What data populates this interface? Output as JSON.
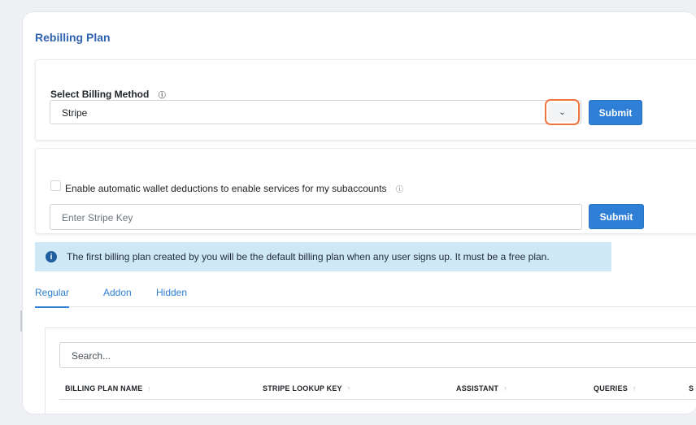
{
  "title": "Rebilling Plan",
  "billing_method": {
    "label": "Select Billing Method",
    "selected": "Stripe",
    "submit_label": "Submit"
  },
  "wallet": {
    "checkbox_label": "Enable automatic wallet deductions to enable services for my subaccounts",
    "checked": false,
    "stripe_key_placeholder": "Enter Stripe Key",
    "submit_label": "Submit"
  },
  "alert": {
    "text": "The first billing plan created by you will be the default billing plan when any user signs up. It must be a free plan."
  },
  "tabs": [
    {
      "label": "Regular",
      "active": true
    },
    {
      "label": "Addon",
      "active": false
    },
    {
      "label": "Hidden",
      "active": false
    }
  ],
  "table": {
    "search_placeholder": "Search...",
    "columns": [
      "BILLING PLAN NAME",
      "STRIPE LOOKUP KEY",
      "ASSISTANT",
      "QUERIES",
      "S"
    ]
  },
  "colors": {
    "accent": "#2f7fd6",
    "title": "#2f63b0",
    "highlight": "#f0743e",
    "alert_bg": "#cfe8f6"
  },
  "icons": {
    "info": "info-icon",
    "chevron": "chevron-down-icon",
    "alert": "info-circle-icon",
    "sort": "sort-arrow-icon"
  }
}
